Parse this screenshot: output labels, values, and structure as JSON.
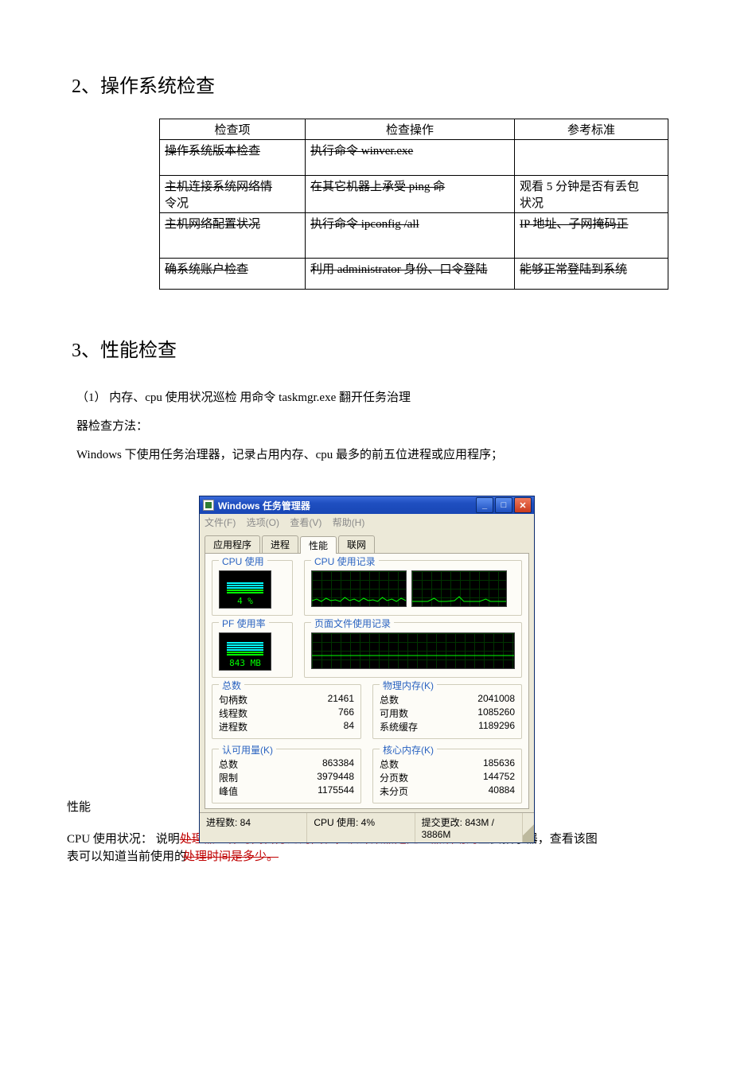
{
  "sec2": {
    "title": "2、操作系统检查"
  },
  "tbl": {
    "headers": [
      "检查项",
      "检查操作",
      "参考标准"
    ],
    "rows": [
      {
        "c1": "操作系统版本检查",
        "c2": "执行命令 winver.exe",
        "c3": ""
      },
      {
        "c1": "主机连接系统网络情",
        "c1b": "令况",
        "c2": "在其它机器上承受 ping 命",
        "c3": "观看 5 分钟是否有丢包",
        "c3b": "状况"
      },
      {
        "c1": "主机网络配置状况",
        "c2": "执行命令 ipconfig /all",
        "c3": "IP 地址、子网掩码正"
      },
      {
        "c1": "确系统账户检查",
        "c2": "利用 administrator 身份、口令登陆",
        "c3": "能够正常登陆到系统"
      }
    ]
  },
  "sec3": {
    "title": "3、性能检查"
  },
  "para1": "（1） 内存、cpu 使用状况巡检 用命令 taskmgr.exe 翻开任务治理",
  "para2": "器检查方法：",
  "para3": "Windows  下使用任务治理器，记录占用内存、cpu 最多的前五位进程或应用程序；",
  "tm": {
    "title": "Windows 任务管理器",
    "menu": {
      "file": "文件(F)",
      "options": "选项(O)",
      "view": "查看(V)",
      "help": "帮助(H)"
    },
    "tabs": {
      "apps": "应用程序",
      "procs": "进程",
      "perf": "性能",
      "net": "联网"
    },
    "groups": {
      "cpuUse": "CPU 使用",
      "cpuHist": "CPU 使用记录",
      "pfUse": "PF 使用率",
      "pfHist": "页面文件使用记录",
      "totals": "总数",
      "phys": "物理内存(K)",
      "commit": "认可用量(K)",
      "kernel": "核心内存(K)"
    },
    "vals": {
      "cpu": "4 %",
      "pf": "843 MB",
      "handles_l": "句柄数",
      "handles": "21461",
      "threads_l": "线程数",
      "threads": "766",
      "procs_l": "进程数",
      "procs": "84",
      "ptotal_l": "总数",
      "ptotal": "2041008",
      "pavail_l": "可用数",
      "pavail": "1085260",
      "pcache_l": "系统缓存",
      "pcache": "1189296",
      "ctotal_l": "总数",
      "ctotal": "863384",
      "climit_l": "限制",
      "climit": "3979448",
      "cpeak_l": "峰值",
      "cpeak": "1175544",
      "ktotal_l": "总数",
      "ktotal": "185636",
      "kpaged_l": "分页数",
      "kpaged": "144752",
      "knon_l": "未分页",
      "knon": "40884"
    },
    "status": {
      "procs": "进程数: 84",
      "cpu": "CPU 使用: 4%",
      "commit": "提交更改: 843M / 3886M"
    }
  },
  "sidelabels": {
    "perf": "性能"
  },
  "overlay": {
    "l1a": "CPU  使用状况：",
    "l1b": "说明",
    "l1c": "处理器工作时间百分比的图表，该计数器是处理器活动的",
    "l1d": "主要指示器，查看该图",
    "l2a": "表可以知道当前使用的",
    "l2b": "处理时间是多少。"
  }
}
